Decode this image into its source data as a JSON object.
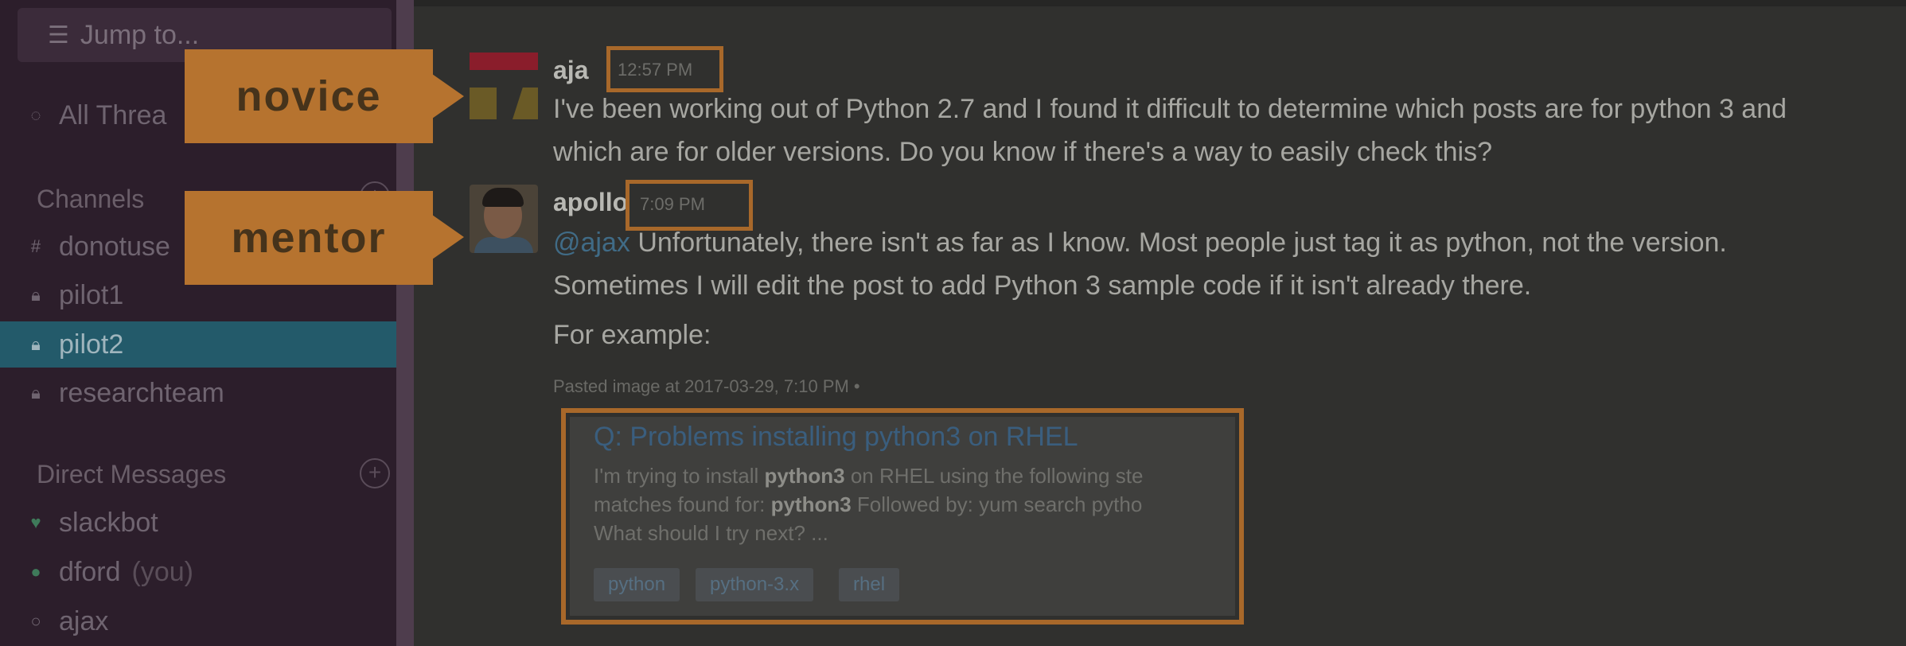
{
  "sidebar": {
    "jump_to": "Jump to...",
    "all_threads": "All Threa",
    "channels_header": "Channels",
    "channels": [
      {
        "name": "donotuse",
        "icon": "hash-icon"
      },
      {
        "name": "pilot1",
        "icon": "lock-icon"
      },
      {
        "name": "pilot2",
        "icon": "lock-icon",
        "active": true
      },
      {
        "name": "researchteam",
        "icon": "lock-icon"
      }
    ],
    "dm_header": "Direct Messages",
    "dms": [
      {
        "name": "slackbot",
        "icon": "heart-icon"
      },
      {
        "name": "dford",
        "suffix": "(you)",
        "icon": "status-icon"
      },
      {
        "name": "ajax",
        "icon": "status-icon"
      }
    ]
  },
  "messages": [
    {
      "author": "aja",
      "time": "12:57 PM",
      "lines": [
        "I've been working out of Python 2.7 and I found it difficult to determine which posts are for python 3 and",
        "which are for older versions. Do you know if there's a way to easily check this?"
      ]
    },
    {
      "author": "apollo",
      "time": "7:09 PM",
      "mention": "@ajax",
      "lines": [
        "Unfortunately, there isn't as far as I know. Most people just tag it as python, not the version.",
        "Sometimes I will edit the post to add Python 3 sample code if it isn't already there.",
        "For example:"
      ]
    }
  ],
  "pasted_label": "Pasted image at 2017-03-29, 7:10 PM",
  "attachment": {
    "title": "Q: Problems installing python3 on RHEL",
    "body_lines": [
      {
        "pre": "I'm trying to install ",
        "bold": "python3",
        "post": " on RHEL using the following ste"
      },
      {
        "pre": "matches found for: ",
        "bold": "python3",
        "post": " Followed by: yum search pytho"
      },
      {
        "pre": "What should I try next? ...",
        "bold": "",
        "post": ""
      }
    ],
    "tags": [
      "python",
      "python-3.x",
      "rhel"
    ]
  },
  "callouts": {
    "novice": "novice",
    "mentor": "mentor"
  },
  "colors": {
    "accent_orange": "#b6732f",
    "sidebar_bg": "#2c1e2b",
    "active_channel": "#235a6a"
  }
}
